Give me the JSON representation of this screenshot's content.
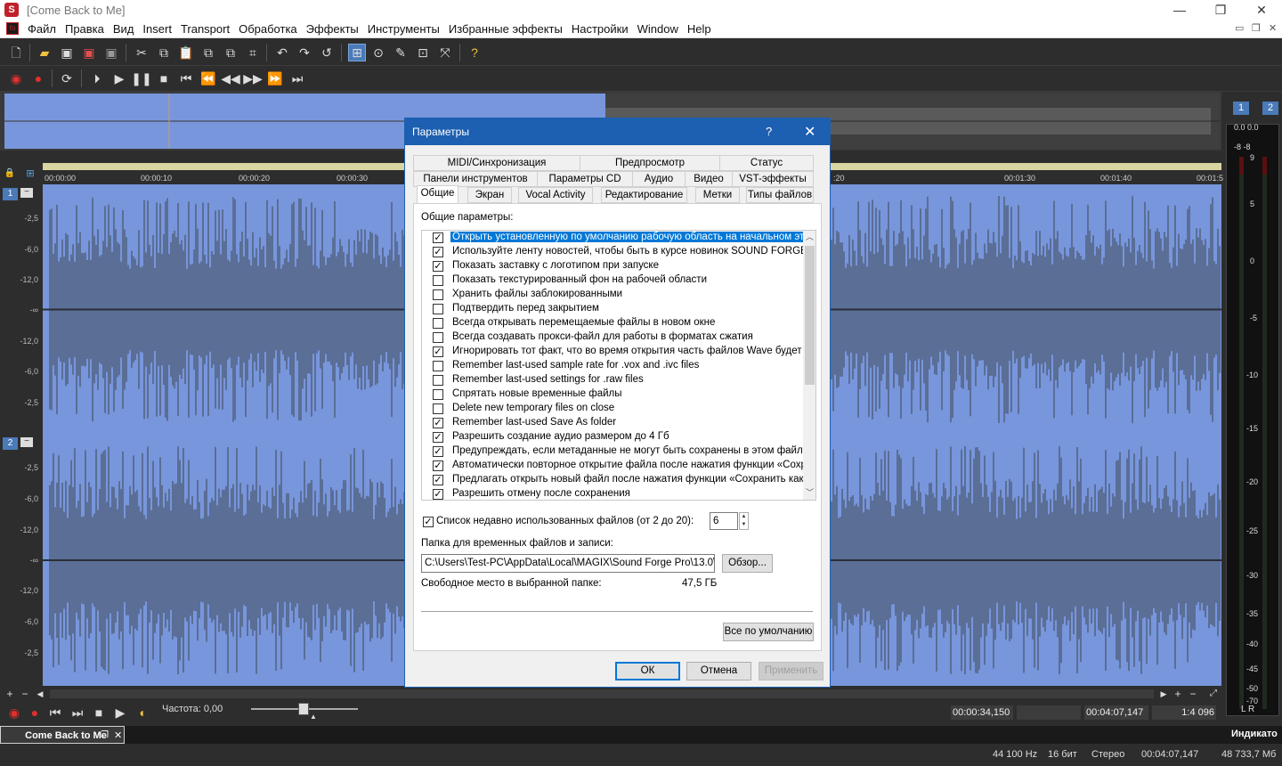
{
  "window": {
    "title": "[Come Back to Me]",
    "minimize": "—",
    "maximize": "❐",
    "close": "✕"
  },
  "menu": [
    "Файл",
    "Правка",
    "Вид",
    "Insert",
    "Transport",
    "Обработка",
    "Эффекты",
    "Инструменты",
    "Избранные эффекты",
    "Настройки",
    "Window",
    "Help"
  ],
  "ruler_ticks": [
    "00:00:00",
    "00:00:10",
    "00:00:20",
    "00:00:30",
    ":20",
    "00:01:30",
    "00:01:40",
    "00:01:50",
    "00:02:0"
  ],
  "db_labels": [
    "-2,5",
    "-6,0",
    "-12,0",
    "-∞",
    "-12,0",
    "-6,0",
    "-2,5"
  ],
  "channels": [
    "1",
    "2"
  ],
  "meter": {
    "ch_labels": [
      "1",
      "2"
    ],
    "top": "0.0 0.0",
    "sub": "-8  -8",
    "scale": [
      "9",
      "5",
      "0",
      "-5",
      "-10",
      "-15",
      "-20",
      "-25",
      "-30",
      "-35",
      "-40",
      "-45",
      "-50",
      "-70"
    ],
    "lr": "L  R",
    "panel_label": "Индикато"
  },
  "transport": {
    "rate_label": "Частота: 0,00",
    "cursor": "00:00:34,150",
    "length": "00:04:07,147",
    "zoom": "1:4 096"
  },
  "tab": {
    "name": "Come Back to Me",
    "close": "✕"
  },
  "status": {
    "rate": "44 100 Hz",
    "bits": "16 бит",
    "channels": "Стерео",
    "length": "00:04:07,147",
    "free": "48 733,7 Мб"
  },
  "dialog": {
    "title": "Параметры",
    "help": "?",
    "close": "✕",
    "tabs_row1": [
      "MIDI/Синхронизация",
      "Предпросмотр",
      "Статус"
    ],
    "tabs_row2": [
      "Панели инструментов",
      "Параметры CD",
      "Аудио",
      "Видео",
      "VST-эффекты"
    ],
    "tabs_row3": [
      "Общие",
      "Экран",
      "Vocal Activity",
      "Редактирование",
      "Метки",
      "Типы файлов"
    ],
    "group_label": "Общие параметры:",
    "options": [
      {
        "text": "Открыть установленную по умолчанию рабочую область на начальном этапе",
        "checked": true
      },
      {
        "text": "Используйте ленту новостей, чтобы быть в курсе новинок SOUND FORGE",
        "checked": true
      },
      {
        "text": "Показать заставку с логотипом при запуске",
        "checked": true
      },
      {
        "text": "Показать текстурированный фон на рабочей области",
        "checked": false
      },
      {
        "text": "Хранить файлы заблокированными",
        "checked": false
      },
      {
        "text": "Подтвердить перед закрытием",
        "checked": false
      },
      {
        "text": "Всегда открывать перемещаемые файлы в новом окне",
        "checked": false
      },
      {
        "text": "Всегда создавать прокси-файл для работы в форматах сжатия",
        "checked": false
      },
      {
        "text": "Игнорировать тот факт, что  во время открытия часть  файлов Wave будет",
        "checked": true
      },
      {
        "text": "Remember last-used sample rate for .vox and .ivc files",
        "checked": false
      },
      {
        "text": "Remember last-used settings for .raw files",
        "checked": false
      },
      {
        "text": "Спрятать новые временные файлы",
        "checked": false
      },
      {
        "text": "Delete new temporary files on close",
        "checked": false
      },
      {
        "text": "Remember last-used Save As folder",
        "checked": true
      },
      {
        "text": "Разрешить создание аудио размером до 4 Гб",
        "checked": true
      },
      {
        "text": "Предупреждать, если метаданные не могут быть сохранены в этом файле",
        "checked": true
      },
      {
        "text": "Автоматически повторное открытие файла после нажатия функции «Сохра",
        "checked": true
      },
      {
        "text": "Предлагать открыть новый файл после нажатия функции «Сохранить как»",
        "checked": true
      },
      {
        "text": "Разрешить отмену после сохранения",
        "checked": true
      }
    ],
    "recent_label": "Список недавно использованных файлов (от 2 до 20):",
    "recent_checked": true,
    "recent_value": "6",
    "temp_folder_label": "Папка для временных файлов и записи:",
    "temp_folder_value": "C:\\Users\\Test-PC\\AppData\\Local\\MAGIX\\Sound Forge Pro\\13.0\\",
    "browse": "Обзор...",
    "free_label": "Свободное место в выбранной папке:",
    "free_value": "47,5 ГБ",
    "defaults": "Все по умолчанию",
    "ok": "ОК",
    "cancel": "Отмена",
    "apply": "Применить"
  }
}
